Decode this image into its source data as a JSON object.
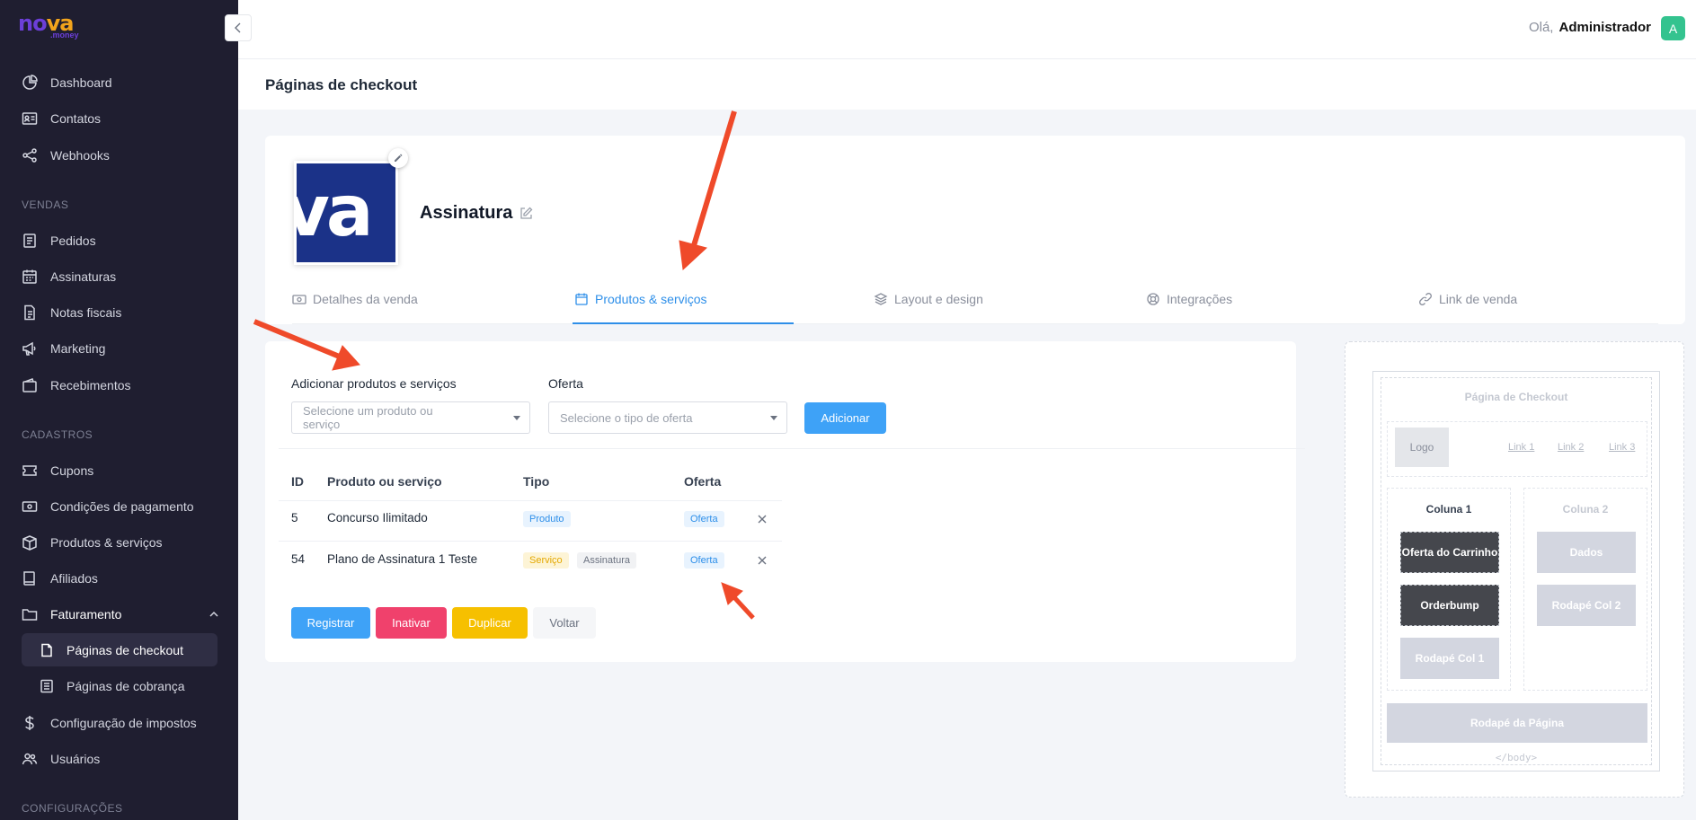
{
  "brand": {
    "name_part1": "no",
    "name_part2": "va",
    "suffix": ".money"
  },
  "sidebar": {
    "items": [
      {
        "label": "Dashboard"
      },
      {
        "label": "Contatos"
      },
      {
        "label": "Webhooks"
      }
    ],
    "section_vendas": "VENDAS",
    "vendas": [
      {
        "label": "Pedidos"
      },
      {
        "label": "Assinaturas"
      },
      {
        "label": "Notas fiscais"
      },
      {
        "label": "Marketing"
      },
      {
        "label": "Recebimentos"
      }
    ],
    "section_cadastros": "CADASTROS",
    "cadastros": [
      {
        "label": "Cupons"
      },
      {
        "label": "Condições de pagamento"
      },
      {
        "label": "Produtos & serviços"
      },
      {
        "label": "Afiliados"
      },
      {
        "label": "Faturamento"
      }
    ],
    "faturamento_sub": [
      {
        "label": "Páginas de checkout"
      },
      {
        "label": "Páginas de cobrança"
      }
    ],
    "more": [
      {
        "label": "Configuração de impostos"
      },
      {
        "label": "Usuários"
      }
    ],
    "section_config": "CONFIGURAÇÕES"
  },
  "topbar": {
    "greeting": "Olá,",
    "user": "Administrador",
    "avatar_letter": "A"
  },
  "page": {
    "title": "Páginas de checkout"
  },
  "product": {
    "name": "Assinatura",
    "image_text": "va"
  },
  "tabs": [
    {
      "label": "Detalhes da venda"
    },
    {
      "label": "Produtos & serviços"
    },
    {
      "label": "Layout e design"
    },
    {
      "label": "Integrações"
    },
    {
      "label": "Link de venda"
    }
  ],
  "form": {
    "product_label": "Adicionar produtos e serviços",
    "product_placeholder": "Selecione um produto ou serviço",
    "offer_label": "Oferta",
    "offer_placeholder": "Selecione o tipo de oferta",
    "add_button": "Adicionar"
  },
  "table": {
    "headers": [
      "ID",
      "Produto ou serviço",
      "Tipo",
      "Oferta"
    ],
    "rows": [
      {
        "id": "5",
        "name": "Concurso Ilimitado",
        "types": [
          "Produto"
        ],
        "offer": "Oferta"
      },
      {
        "id": "54",
        "name": "Plano de Assinatura 1 Teste",
        "types": [
          "Serviço",
          "Assinatura"
        ],
        "offer": "Oferta"
      }
    ]
  },
  "actions": {
    "register": "Registrar",
    "inactivate": "Inativar",
    "duplicate": "Duplicar",
    "back": "Voltar"
  },
  "preview": {
    "title": "Página de Checkout",
    "logo": "Logo",
    "links": [
      "Link 1",
      "Link 2",
      "Link 3"
    ],
    "col1_title": "Coluna 1",
    "col1_blocks": [
      "Oferta do Carrinho",
      "Orderbump",
      "Rodapé Col 1"
    ],
    "col2_title": "Coluna 2",
    "col2_blocks": [
      "Dados",
      "Rodapé Col 2"
    ],
    "footer": "Rodapé da Página",
    "body_tag": "</body>"
  },
  "colors": {
    "accent": "#2e8fe9",
    "sidebar_bg": "#1f1e30",
    "annotation_arrow": "#ef4a2a"
  }
}
